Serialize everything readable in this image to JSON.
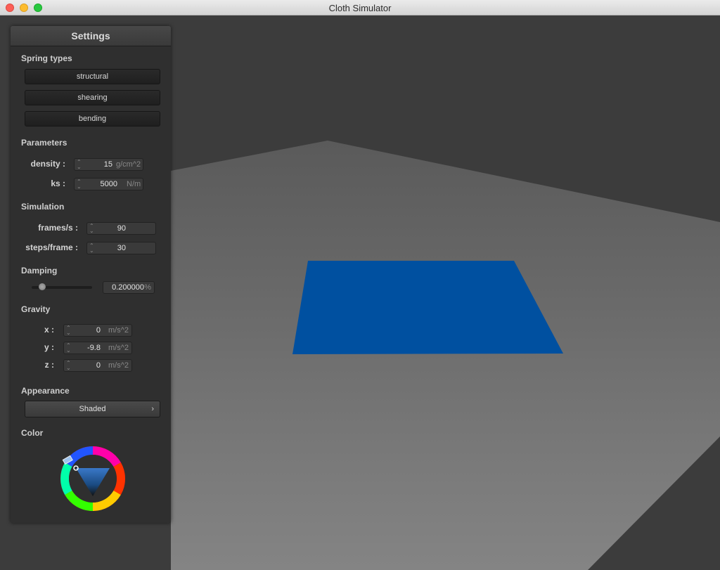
{
  "window": {
    "title": "Cloth Simulator"
  },
  "panel": {
    "title": "Settings",
    "spring_types": {
      "heading": "Spring types",
      "buttons": [
        "structural",
        "shearing",
        "bending"
      ]
    },
    "parameters": {
      "heading": "Parameters",
      "density": {
        "label": "density :",
        "value": "15",
        "unit": "g/cm^2"
      },
      "ks": {
        "label": "ks :",
        "value": "5000",
        "unit": "N/m"
      }
    },
    "simulation": {
      "heading": "Simulation",
      "fps": {
        "label": "frames/s :",
        "value": "90"
      },
      "steps": {
        "label": "steps/frame :",
        "value": "30"
      }
    },
    "damping": {
      "heading": "Damping",
      "value": "0.200000",
      "unit": "%",
      "level": 0.2
    },
    "gravity": {
      "heading": "Gravity",
      "x": {
        "label": "x :",
        "value": "0",
        "unit": "m/s^2"
      },
      "y": {
        "label": "y :",
        "value": "-9.8",
        "unit": "m/s^2"
      },
      "z": {
        "label": "z :",
        "value": "0",
        "unit": "m/s^2"
      }
    },
    "appearance": {
      "heading": "Appearance",
      "selected": "Shaded"
    },
    "color": {
      "heading": "Color",
      "selected_hex": "#0055a5"
    }
  },
  "scene": {
    "floor_color": "#6e6e6e",
    "cloth_color": "#0050a0",
    "background_color": "#3c3c3c"
  }
}
